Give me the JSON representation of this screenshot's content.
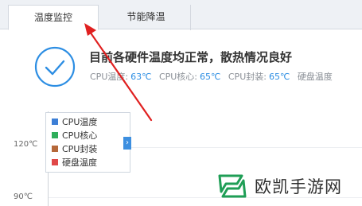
{
  "tabs": [
    {
      "label": "温度监控",
      "active": true
    },
    {
      "label": "节能降温",
      "active": false
    }
  ],
  "status": {
    "icon": "check-circle-icon",
    "headline": "目前各硬件温度均正常，散热情况良好",
    "readings": [
      {
        "label": "CPU温度:",
        "value": "63℃"
      },
      {
        "label": "CPU核心:",
        "value": "65℃"
      },
      {
        "label": "CPU封装:",
        "value": "65℃"
      },
      {
        "label": "硬盘温度",
        "value": ""
      }
    ]
  },
  "chart": {
    "y_ticks": [
      "120℃",
      "90℃"
    ],
    "legend": [
      {
        "label": "CPU温度",
        "color": "#3d7fd6"
      },
      {
        "label": "CPU核心",
        "color": "#2fae5b"
      },
      {
        "label": "CPU封装",
        "color": "#b5683a"
      },
      {
        "label": "硬盘温度",
        "color": "#e04848"
      }
    ],
    "legend_toggle": "›"
  },
  "watermark": {
    "text": "欧凯手游网"
  },
  "colors": {
    "accent": "#2d8ee3",
    "arrow": "#e02020"
  }
}
